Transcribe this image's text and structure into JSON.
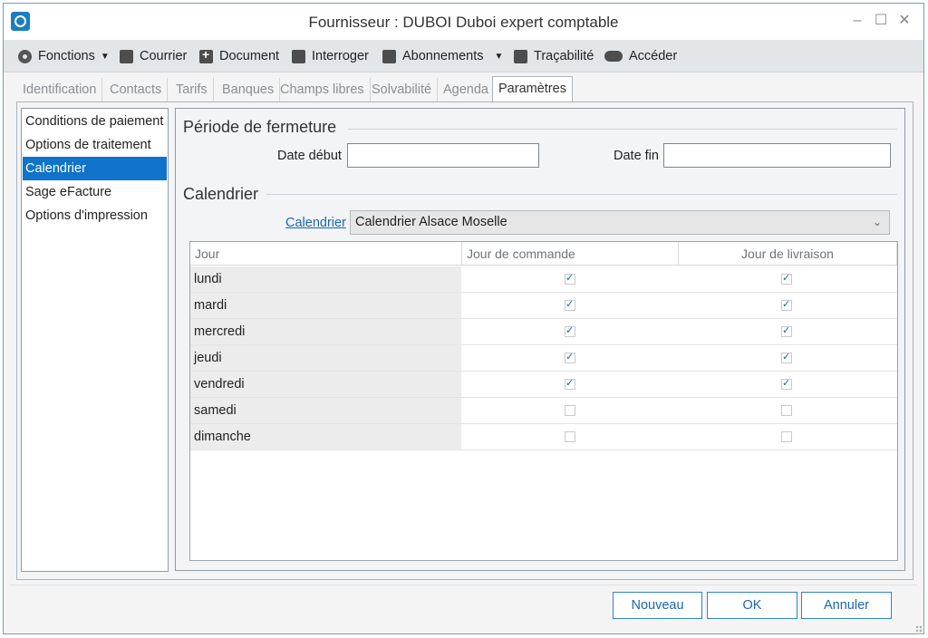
{
  "window": {
    "title": "Fournisseur : DUBOI Duboi expert comptable",
    "controls": {
      "minimize": "–",
      "maximize": "☐",
      "close": "✕"
    }
  },
  "toolbar": {
    "items": [
      {
        "label": "Fonctions",
        "icon": "gear-icon",
        "has_dropdown": true
      },
      {
        "label": "Courrier",
        "icon": "word-icon"
      },
      {
        "label": "Document",
        "icon": "document-add-icon"
      },
      {
        "label": "Interroger",
        "icon": "table-icon"
      },
      {
        "label": "Abonnements",
        "icon": "calendar-icon",
        "has_dropdown": true
      },
      {
        "label": "Traçabilité",
        "icon": "trace-icon"
      },
      {
        "label": "Accéder",
        "icon": "cloud-icon"
      }
    ],
    "dropdown_glyph": "▼"
  },
  "tabs": {
    "items": [
      "Identification",
      "Contacts",
      "Tarifs",
      "Banques",
      "Champs libres",
      "Solvabilité",
      "Agenda",
      "Paramètres"
    ],
    "active": "Paramètres"
  },
  "sidebar": {
    "items": [
      "Conditions de paiement",
      "Options de traitement",
      "Calendrier",
      "Sage eFacture",
      "Options d'impression"
    ],
    "selected": "Calendrier"
  },
  "periode": {
    "title": "Période de fermeture",
    "date_debut_label": "Date début",
    "date_debut_value": "",
    "date_fin_label": "Date fin",
    "date_fin_value": ""
  },
  "calendrier": {
    "title": "Calendrier",
    "link_label": "Calendrier",
    "selected_value": "Calendrier Alsace Moselle",
    "chevron": "⌄"
  },
  "grid": {
    "columns": [
      "Jour",
      "Jour de commande",
      "Jour de livraison"
    ],
    "rows": [
      {
        "day": "lundi",
        "commande": true,
        "livraison": true
      },
      {
        "day": "mardi",
        "commande": true,
        "livraison": true
      },
      {
        "day": "mercredi",
        "commande": true,
        "livraison": true
      },
      {
        "day": "jeudi",
        "commande": true,
        "livraison": true
      },
      {
        "day": "vendredi",
        "commande": true,
        "livraison": true
      },
      {
        "day": "samedi",
        "commande": false,
        "livraison": false
      },
      {
        "day": "dimanche",
        "commande": false,
        "livraison": false
      }
    ]
  },
  "footer": {
    "nouveau": "Nouveau",
    "ok": "OK",
    "annuler": "Annuler"
  },
  "colors": {
    "accent": "#0f73c9",
    "link": "#1a67b3",
    "check": "#1565a8"
  }
}
